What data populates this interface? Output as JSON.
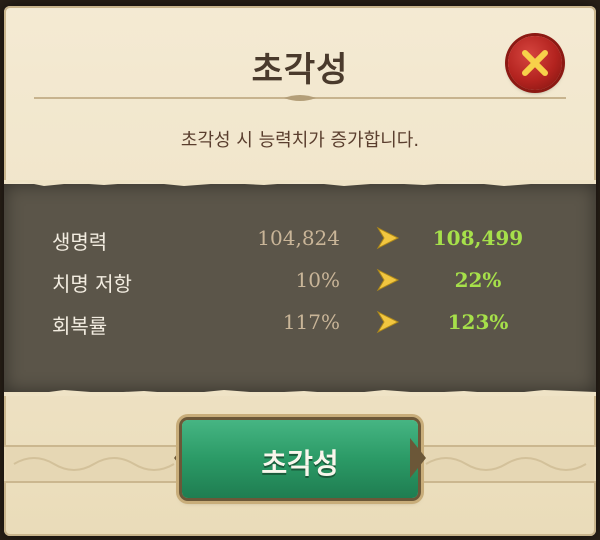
{
  "dialog": {
    "title": "초각성",
    "subtitle": "초각성 시 능력치가 증가합니다.",
    "close_icon": "close-x-icon"
  },
  "stats": [
    {
      "label": "생명력",
      "before": "104,824",
      "after": "108,499"
    },
    {
      "label": "치명 저항",
      "before": "10%",
      "after": "22%"
    },
    {
      "label": "회복률",
      "before": "117%",
      "after": "123%"
    }
  ],
  "action": {
    "label": "초각성"
  },
  "colors": {
    "after_value": "#a6e04a",
    "before_value": "#c9b598",
    "button_green": "#2b9a66",
    "close_red": "#b3231f"
  }
}
